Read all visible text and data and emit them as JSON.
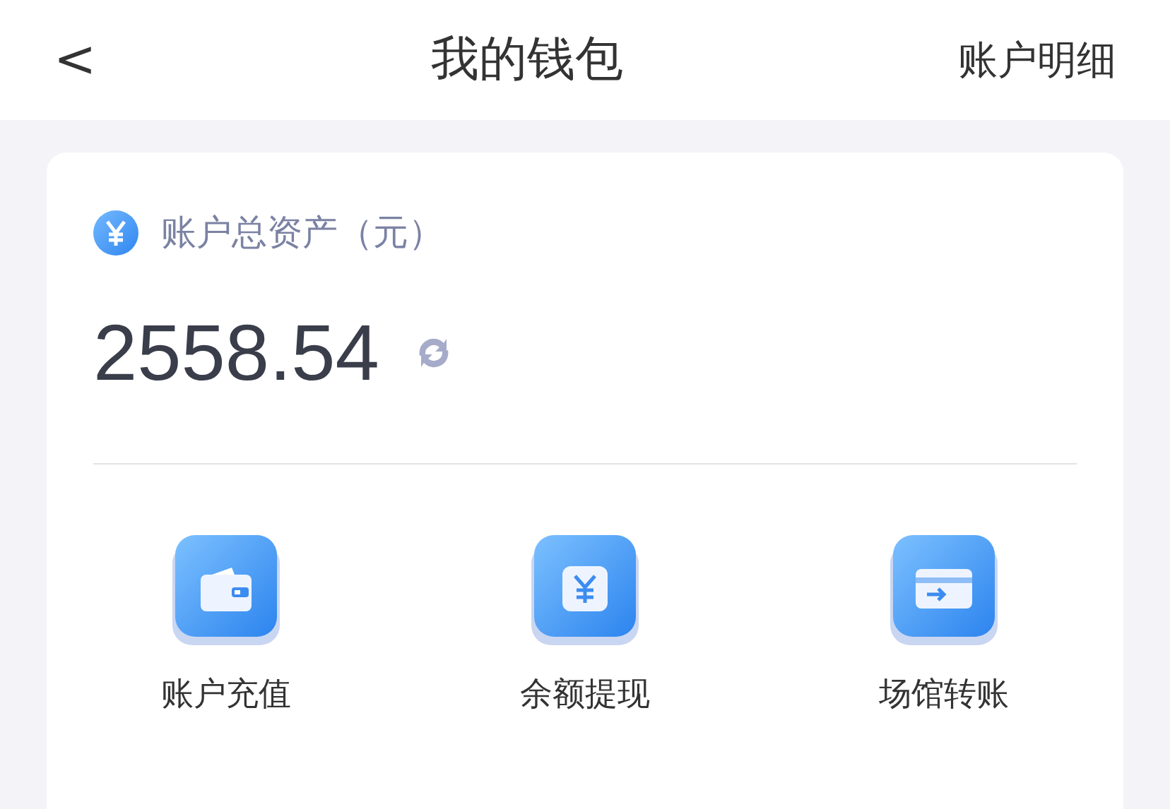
{
  "header": {
    "back": "<",
    "title": "我的钱包",
    "action": "账户明细"
  },
  "balance": {
    "label": "账户总资产（元）",
    "amount": "2558.54"
  },
  "actions": [
    {
      "kind": "wallet",
      "label": "账户充值"
    },
    {
      "kind": "yen",
      "label": "余额提现"
    },
    {
      "kind": "card",
      "label": "场馆转账"
    }
  ]
}
